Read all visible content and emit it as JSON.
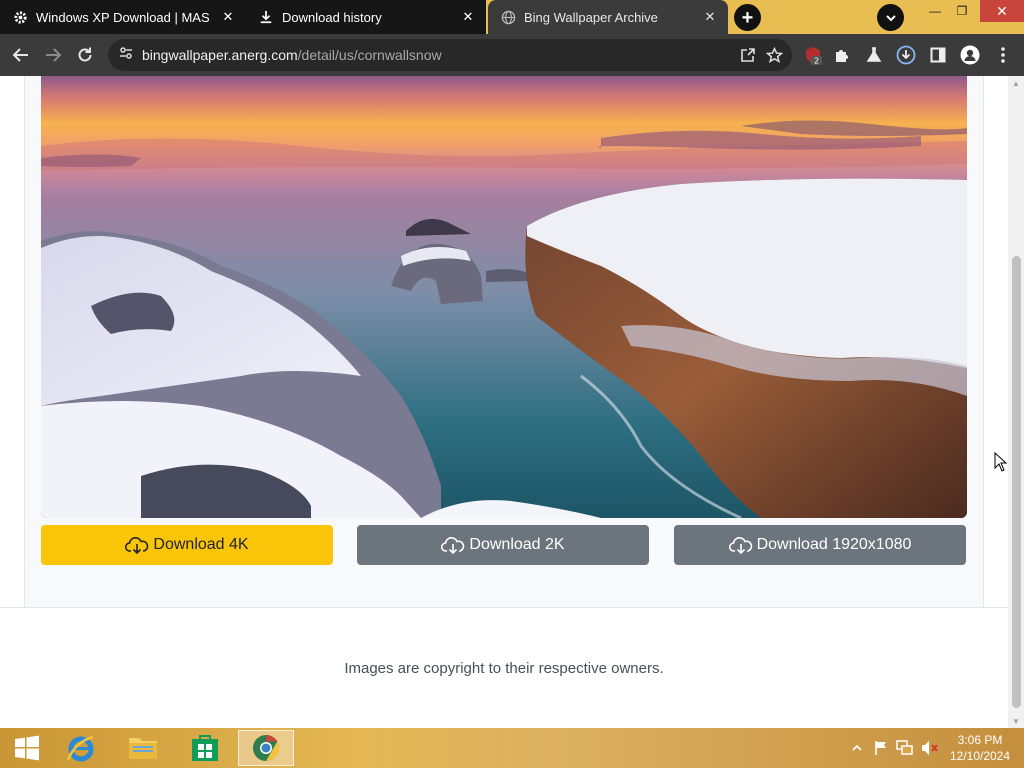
{
  "tabs": [
    {
      "title": "Windows XP Download | MAS",
      "icon": "gear-icon",
      "state": "inactive"
    },
    {
      "title": "Download history",
      "icon": "download-icon",
      "state": "inactive"
    },
    {
      "title": "Bing Wallpaper Archive",
      "icon": "globe-icon",
      "state": "active"
    }
  ],
  "toolbar": {
    "url_host": "bingwallpaper.anerg.com",
    "url_path": "/detail/us/cornwallsnow",
    "extension_badge": "2"
  },
  "page": {
    "download_buttons": [
      {
        "label": "Download 4K",
        "style": "primary"
      },
      {
        "label": "Download 2K",
        "style": "secondary"
      },
      {
        "label": "Download 1920x1080",
        "style": "secondary"
      }
    ],
    "footer": "Images are copyright to their respective owners."
  },
  "taskbar": {
    "time": "3:06 PM",
    "date": "12/10/2024"
  },
  "colors": {
    "accent_yellow": "#fac409",
    "secondary_gray": "#6c757d",
    "tab_strip": "#e8be52",
    "toolbar": "#3b3b3b"
  }
}
